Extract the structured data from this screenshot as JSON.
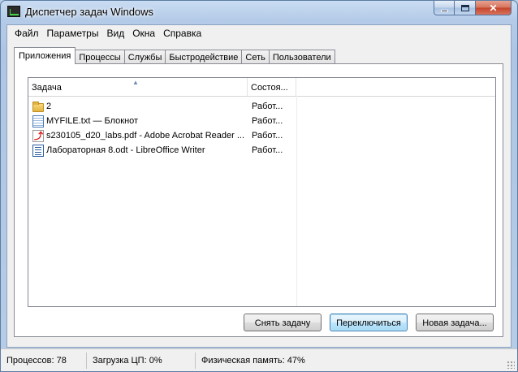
{
  "window": {
    "title": "Диспетчер задач Windows",
    "close_glyph": "✕"
  },
  "menu": [
    "Файл",
    "Параметры",
    "Вид",
    "Окна",
    "Справка"
  ],
  "tabs": [
    "Приложения",
    "Процессы",
    "Службы",
    "Быстродействие",
    "Сеть",
    "Пользователи"
  ],
  "active_tab": "Приложения",
  "list": {
    "columns": [
      "Задача",
      "Состоя..."
    ],
    "sort_column": "Задача",
    "sort_arrow": "▲",
    "rows": [
      {
        "icon": "folder-icon",
        "task": "2",
        "status": "Работ..."
      },
      {
        "icon": "notepad-icon",
        "task": "MYFILE.txt — Блокнот",
        "status": "Работ..."
      },
      {
        "icon": "pdf-icon",
        "task": "s230105_d20_labs.pdf - Adobe Acrobat Reader ...",
        "status": "Работ..."
      },
      {
        "icon": "writer-icon",
        "task": "Лабораторная 8.odt - LibreOffice Writer",
        "status": "Работ..."
      }
    ]
  },
  "buttons": {
    "end_task": "Снять задачу",
    "switch_to": "Переключиться",
    "new_task": "Новая задача..."
  },
  "status": {
    "processes": "Процессов: 78",
    "cpu": "Загрузка ЦП: 0%",
    "memory": "Физическая память: 47%"
  }
}
